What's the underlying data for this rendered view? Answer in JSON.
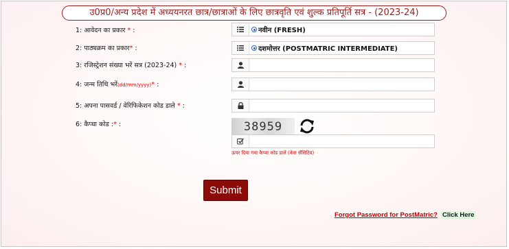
{
  "header": {
    "title": "उ0प्र0/अन्य प्रदेश में अध्ययनरत छात्र/छात्राओं के लिए छात्रवृति एवं शुल्क प्रतिपूर्ति सत्र - (2023-24)"
  },
  "form": {
    "application_type": {
      "label": "1: आवेदन का प्रकार ",
      "required": "*",
      "suffix": " :",
      "value": "नवीन (FRESH)",
      "icon": "list-icon"
    },
    "course_type": {
      "label": "2: पाठ्यक्रम का प्रकार",
      "required": "*",
      "suffix": " :",
      "value": "दशमोत्तर (POSTMATRIC INTERMEDIATE)",
      "icon": "list-icon"
    },
    "registration_no": {
      "label": "3: रजिस्ट्रेशन संख्या भरें सत्र (2023-24) ",
      "required": "*",
      "suffix": " :",
      "value": "",
      "icon": "user-icon"
    },
    "dob": {
      "label": "4: जन्म तिथि भरें",
      "hint": "(dd/mm/yyyy)",
      "required": "*",
      "suffix": " :",
      "value": "",
      "icon": "user-icon"
    },
    "password": {
      "label": "5: अपना पासवर्ड / वेरिफिकेशन कोड डाले ",
      "required": "*",
      "suffix": " :",
      "value": "",
      "icon": "lock-icon"
    },
    "captcha": {
      "label": "6: कैप्चा कोड :",
      "required": "*",
      "suffix": " :",
      "code": "38959",
      "value": "",
      "icon": "check-icon",
      "hint": "ऊपर दिया गया कैप्चा कोड डालें (केस सेंसिटिव)"
    }
  },
  "actions": {
    "submit_label": "Submit",
    "forgot_label": "Forgot Password for PostMatric?",
    "click_here_label": "Click Here"
  },
  "colors": {
    "brand": "#8b0a0a",
    "title_border": "#9a1e1e",
    "required": "#e00000",
    "frame_border": "#e6c76a"
  }
}
